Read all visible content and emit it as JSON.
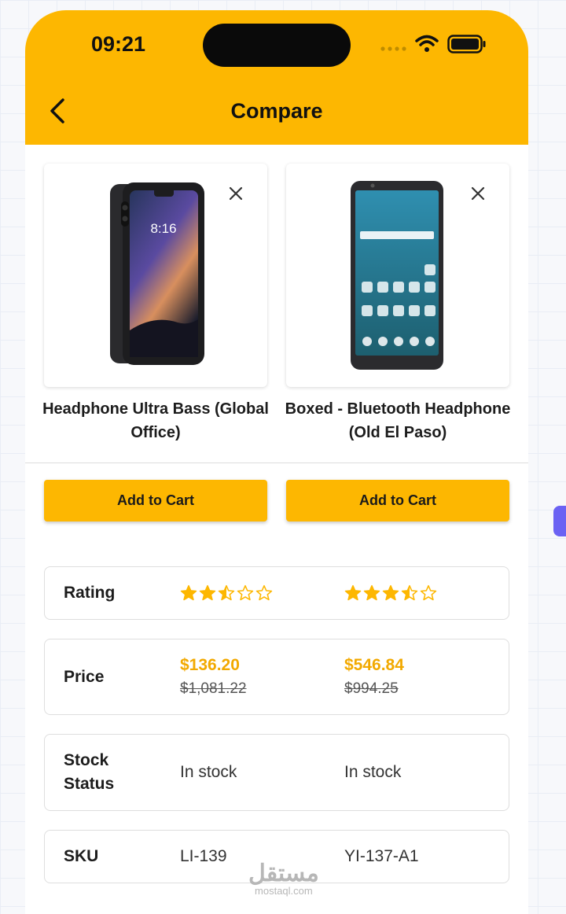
{
  "status_bar": {
    "time": "09:21"
  },
  "header": {
    "title": "Compare"
  },
  "icons": {
    "back": "chevron-left-icon",
    "close": "close-icon",
    "signal": "signal-dots-icon",
    "wifi": "wifi-icon",
    "battery": "battery-icon",
    "star_full": "star-icon",
    "star_half": "star-half-icon",
    "star_empty": "star-outline-icon"
  },
  "colors": {
    "accent": "#fdb701",
    "price": "#f2a900",
    "scroll_tab": "#6b62f3"
  },
  "products": [
    {
      "name": "Headphone Ultra Bass (Global Office)",
      "add_to_cart": "Add to Cart",
      "rating": 2.5,
      "price": "$136.20",
      "old_price": "$1,081.22",
      "stock_status": "In stock",
      "sku": "LI-139"
    },
    {
      "name": "Boxed - Bluetooth Headphone (Old El Paso)",
      "add_to_cart": "Add to Cart",
      "rating": 3.5,
      "price": "$546.84",
      "old_price": "$994.25",
      "stock_status": "In stock",
      "sku": "YI-137-A1"
    }
  ],
  "rows": {
    "rating": "Rating",
    "price": "Price",
    "stock_status": "Stock Status",
    "sku": "SKU"
  },
  "watermark": {
    "main": "مستقل",
    "sub": "mostaql.com"
  }
}
